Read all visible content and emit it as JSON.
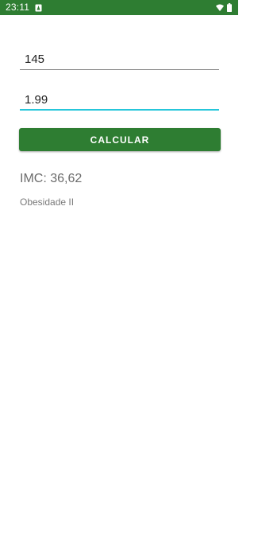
{
  "status_bar": {
    "time": "23:11",
    "color": "#2e7d32",
    "icons": [
      "notification-icon",
      "wifi-icon",
      "battery-icon"
    ]
  },
  "form": {
    "weight_value": "145",
    "height_value": "1.99",
    "focus_color": "#26c6da"
  },
  "button": {
    "label": "CALCULAR",
    "color": "#2e7d32"
  },
  "result": {
    "imc_text": "IMC: 36,62",
    "classification": "Obesidade II"
  }
}
